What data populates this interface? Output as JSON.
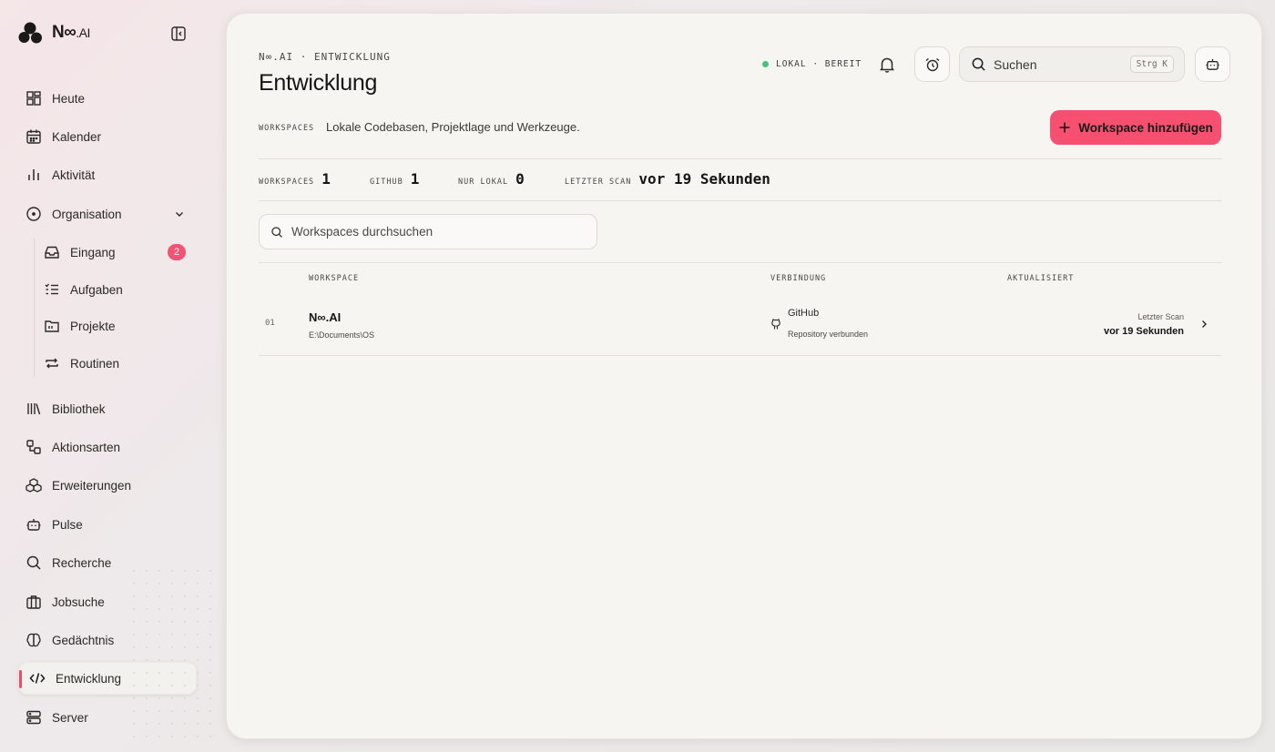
{
  "brand": {
    "name": "N∞",
    "suffix": ".AI"
  },
  "sidebar": {
    "items": [
      {
        "label": "Heute",
        "icon": "grid-icon"
      },
      {
        "label": "Kalender",
        "icon": "calendar-icon"
      },
      {
        "label": "Aktivität",
        "icon": "bar-chart-icon"
      },
      {
        "label": "Organisation",
        "icon": "compass-icon"
      },
      {
        "label": "Eingang",
        "icon": "inbox-icon",
        "badge": "2"
      },
      {
        "label": "Aufgaben",
        "icon": "checklist-icon"
      },
      {
        "label": "Projekte",
        "icon": "folder-icon"
      },
      {
        "label": "Routinen",
        "icon": "repeat-icon"
      },
      {
        "label": "Bibliothek",
        "icon": "library-icon"
      },
      {
        "label": "Aktionsarten",
        "icon": "shapes-icon"
      },
      {
        "label": "Erweiterungen",
        "icon": "extensions-icon"
      },
      {
        "label": "Pulse",
        "icon": "bot-icon"
      },
      {
        "label": "Recherche",
        "icon": "search-icon"
      },
      {
        "label": "Jobsuche",
        "icon": "briefcase-icon"
      },
      {
        "label": "Gedächtnis",
        "icon": "brain-icon"
      },
      {
        "label": "Entwicklung",
        "icon": "code-icon",
        "active": true
      },
      {
        "label": "Server",
        "icon": "server-icon"
      }
    ]
  },
  "header": {
    "breadcrumb": "N∞.AI · ENTWICKLUNG",
    "title": "Entwicklung",
    "status": "LOKAL · BEREIT",
    "status_color": "#46c37b",
    "search_placeholder": "Suchen",
    "search_shortcut": "Strg K"
  },
  "intro": {
    "label": "WORKSPACES",
    "text": "Lokale Codebasen, Projektlage und Werkzeuge.",
    "add_button": "Workspace hinzufügen",
    "accent": "#f5506f"
  },
  "stats": [
    {
      "label": "WORKSPACES",
      "value": "1"
    },
    {
      "label": "GITHUB",
      "value": "1"
    },
    {
      "label": "NUR LOKAL",
      "value": "0"
    },
    {
      "label": "LETZTER SCAN",
      "value": "vor 19 Sekunden"
    }
  ],
  "filter": {
    "placeholder": "Workspaces durchsuchen"
  },
  "table": {
    "columns": [
      "WORKSPACE",
      "VERBINDUNG",
      "AKTUALISIERT"
    ],
    "rows": [
      {
        "num": "01",
        "name": "N∞.AI",
        "path": "E:\\Documents\\OS",
        "connection": "GitHub",
        "connection_sub": "Repository verbunden",
        "scan_label": "Letzter Scan",
        "scan_value": "vor 19 Sekunden"
      }
    ]
  }
}
